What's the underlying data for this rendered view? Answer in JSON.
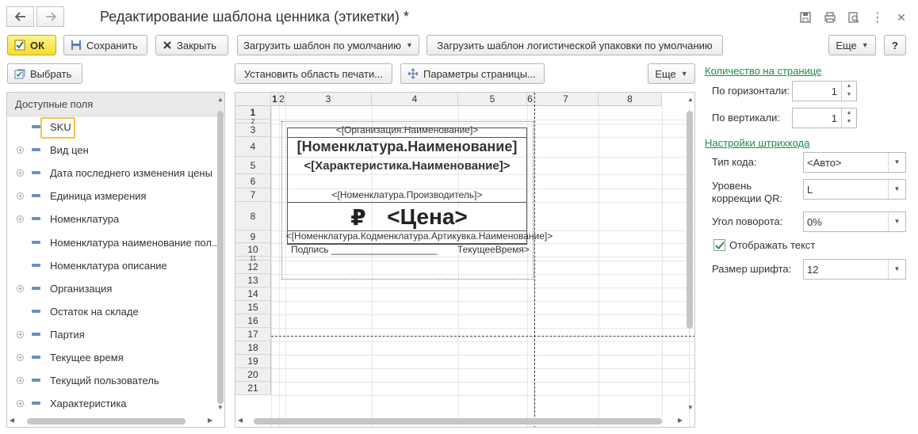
{
  "window": {
    "title": "Редактирование шаблона ценника (этикетки) *",
    "more_symbol": "⋮",
    "close_symbol": "✕"
  },
  "toolbar": {
    "ok": "ОК",
    "save": "Сохранить",
    "close": "Закрыть",
    "load_default": "Загрузить шаблон по умолчанию",
    "load_logistic": "Загрузить шаблон логистической упаковки по умолчанию",
    "more": "Еще",
    "help": "?"
  },
  "left_panel": {
    "select_button": "Выбрать",
    "header": "Доступные поля",
    "fields": [
      {
        "label": "SKU",
        "expandable": false
      },
      {
        "label": "Вид цен",
        "expandable": true
      },
      {
        "label": "Дата последнего изменения цены",
        "expandable": true
      },
      {
        "label": "Единица измерения",
        "expandable": true
      },
      {
        "label": "Номенклатура",
        "expandable": true
      },
      {
        "label": "Номенклатура наименование пол...",
        "expandable": false
      },
      {
        "label": "Номенклатура описание",
        "expandable": false
      },
      {
        "label": "Организация",
        "expandable": true
      },
      {
        "label": "Остаток на складе",
        "expandable": false
      },
      {
        "label": "Партия",
        "expandable": true
      },
      {
        "label": "Текущее время",
        "expandable": true
      },
      {
        "label": "Текущий пользователь",
        "expandable": true
      },
      {
        "label": "Характеристика",
        "expandable": true
      }
    ]
  },
  "sheet_toolbar": {
    "set_print_area": "Установить область печати...",
    "page_params": "Параметры страницы...",
    "more": "Еще"
  },
  "sheet": {
    "columns": [
      "1",
      "2",
      "3",
      "4",
      "5",
      "6",
      "7",
      "8"
    ],
    "rows": [
      "1",
      "2",
      "3",
      "4",
      "5",
      "6",
      "7",
      "8",
      "9",
      "10",
      "11",
      "12",
      "13",
      "14",
      "15",
      "16",
      "17",
      "18",
      "19",
      "20",
      "21"
    ],
    "cells": {
      "org": "<[Организация.Наименование]>",
      "nom": "[Номенклатура.Наименование]",
      "char": "<[Характеристика.Наименование]>",
      "manuf": "<[Номенклатура.Производитель]>",
      "ruble": "₽",
      "price": "<Цена>",
      "row9": "<[Номенклатура.Кодменклатура.Артикувка.Наименование]>",
      "row10_left": "Подпись ____________________",
      "row10_right": "ТекущееВремя>"
    }
  },
  "right_panel": {
    "qty_section": "Количество на странице",
    "horizontal_label": "По горизонтали:",
    "horizontal_value": "1",
    "vertical_label": "По вертикали:",
    "vertical_value": "1",
    "barcode_section": "Настройки штрихкода",
    "code_type_label": "Тип кода:",
    "code_type_value": "<Авто>",
    "qr_level_label": "Уровень коррекции QR:",
    "qr_level_value": "L",
    "rotation_label": "Угол поворота:",
    "rotation_value": "0%",
    "show_text_label": "Отображать текст",
    "show_text_checked": true,
    "font_size_label": "Размер шрифта:",
    "font_size_value": "12"
  },
  "colors": {
    "accent_yellow": "#f6dc2e",
    "link_green": "#1e8a4a",
    "field_dash_blue": "#6a8fbf",
    "sku_highlight": "#f5c33b"
  }
}
